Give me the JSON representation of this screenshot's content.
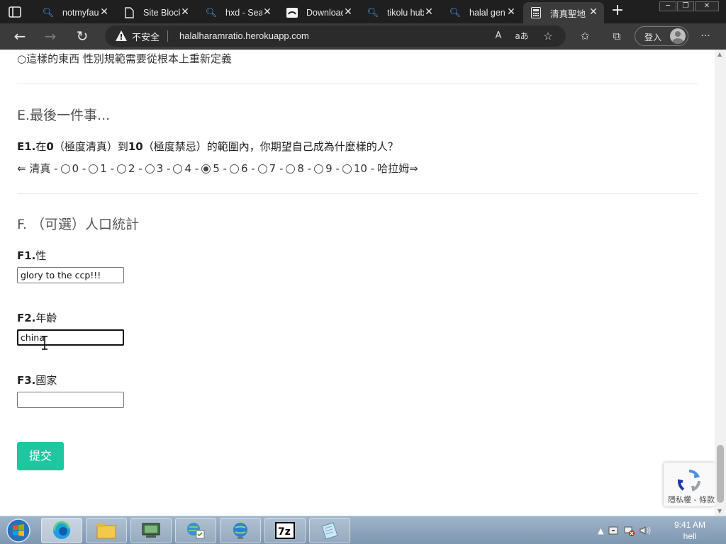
{
  "browser": {
    "tabs": [
      {
        "title": "notmyfault",
        "icon": "search-icon"
      },
      {
        "title": "Site Blocked",
        "icon": "document-icon"
      },
      {
        "title": "hxd - Search",
        "icon": "search-icon"
      },
      {
        "title": "Downloads",
        "icon": "download-site-icon"
      },
      {
        "title": "tikolu hub",
        "icon": "search-icon"
      },
      {
        "title": "halal gen",
        "icon": "search-icon"
      },
      {
        "title": "清真聖地",
        "icon": "calculator-icon"
      }
    ],
    "active_tab": 6,
    "address": {
      "security_label": "不安全",
      "url": "halalharamratio.herokuapp.com"
    },
    "login_label": "登入",
    "read_aloud_glyph": "A",
    "translate_glyph": "aあ",
    "more_glyph": "···"
  },
  "form": {
    "prev_option": "○這樣的東西 性別規範需要從根本上重新定義",
    "section_e": "E.最後一件事...",
    "e1": {
      "label_bold": "E1.",
      "label_text": "在",
      "zero": "0",
      "mid1": "（極度清真）到",
      "ten": "10",
      "mid2": "（極度禁忌）的範圍內，你期望自己成為什麼樣的人？"
    },
    "scale": {
      "left_label": "⇐ 清真 -",
      "options": [
        "0 -",
        "1 -",
        "2 -",
        "3 -",
        "4 -",
        "5 -",
        "6 -",
        "7 -",
        "8 -",
        "9 -",
        "10 -"
      ],
      "selected_index": 5,
      "right_label": "哈拉姆⇒"
    },
    "section_f": "F. （可選）人口統計",
    "f1": {
      "label_bold": "F1.",
      "label_text": "性",
      "value": "glory to the ccp!!!"
    },
    "f2": {
      "label_bold": "F2.",
      "label_text": "年齡",
      "value": "china"
    },
    "f3": {
      "label_bold": "F3.",
      "label_text": "國家",
      "value": ""
    },
    "submit_label": "提交",
    "recaptcha_links": "隱私權 - 條款"
  },
  "taskbar": {
    "clock_time": "9:41 AM",
    "clock_label": "hell",
    "tray_chevron": "▲"
  },
  "colors": {
    "accent": "#1ec7a0",
    "titlebar": "#1f1f1f",
    "toolbar": "#3b3b3b"
  }
}
